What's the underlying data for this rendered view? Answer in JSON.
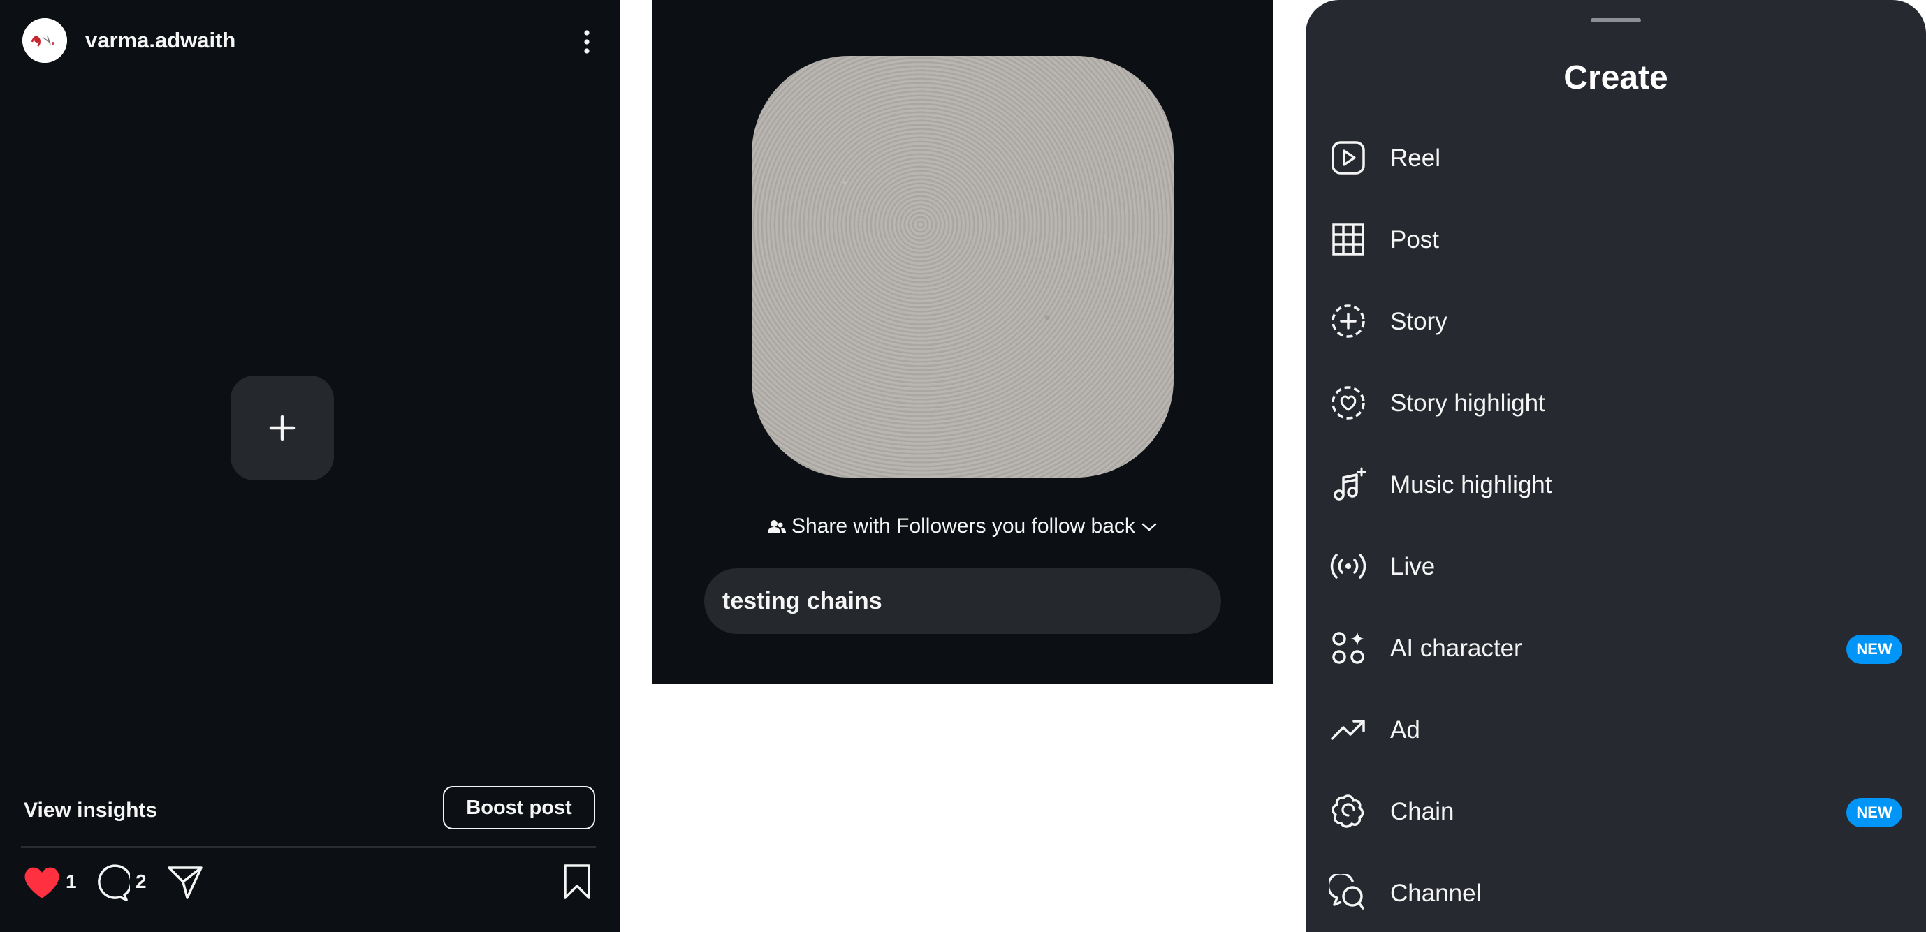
{
  "post": {
    "username": "varma.adwaith",
    "view_insights": "View insights",
    "boost_post": "Boost post",
    "like_count": "1",
    "comment_count": "2"
  },
  "chain_share": {
    "share_text": "Share with Followers you follow back",
    "caption": "testing chains"
  },
  "create_sheet": {
    "title": "Create",
    "items": [
      {
        "label": "Reel",
        "icon": "reel-icon"
      },
      {
        "label": "Post",
        "icon": "grid-icon"
      },
      {
        "label": "Story",
        "icon": "story-add-icon"
      },
      {
        "label": "Story highlight",
        "icon": "story-highlight-icon"
      },
      {
        "label": "Music highlight",
        "icon": "music-note-icon"
      },
      {
        "label": "Live",
        "icon": "live-broadcast-icon"
      },
      {
        "label": "AI character",
        "icon": "ai-character-icon",
        "badge": "NEW"
      },
      {
        "label": "Ad",
        "icon": "trend-arrow-icon"
      },
      {
        "label": "Chain",
        "icon": "chain-icon",
        "badge": "NEW"
      },
      {
        "label": "Channel",
        "icon": "channel-icon"
      }
    ]
  },
  "colors": {
    "dark_bg": "#0c1014",
    "sheet_bg": "#262a30",
    "like_red": "#ff3040",
    "badge_blue": "#0095f6"
  }
}
